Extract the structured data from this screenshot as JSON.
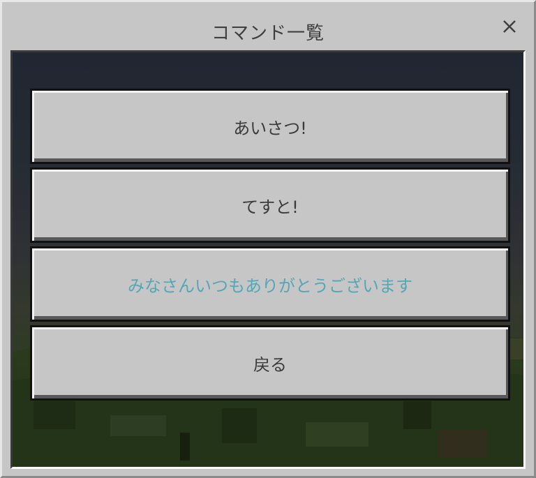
{
  "dialog": {
    "title": "コマンド一覧",
    "close_icon": "close-icon",
    "close_symbol": "✕"
  },
  "buttons": [
    {
      "label": "あいさつ!",
      "color": "#3b3b3b"
    },
    {
      "label": "てすと!",
      "color": "#3b3b3b"
    },
    {
      "label": "みなさんいつもありがとうございます",
      "color": "#54a7b4"
    },
    {
      "label": "戻る",
      "color": "#3b3b3b"
    }
  ],
  "colors": {
    "panel": "#c6c6c6",
    "highlight_text": "#54a7b4",
    "sky_top": "#222632",
    "grass": "#2f3b22"
  }
}
